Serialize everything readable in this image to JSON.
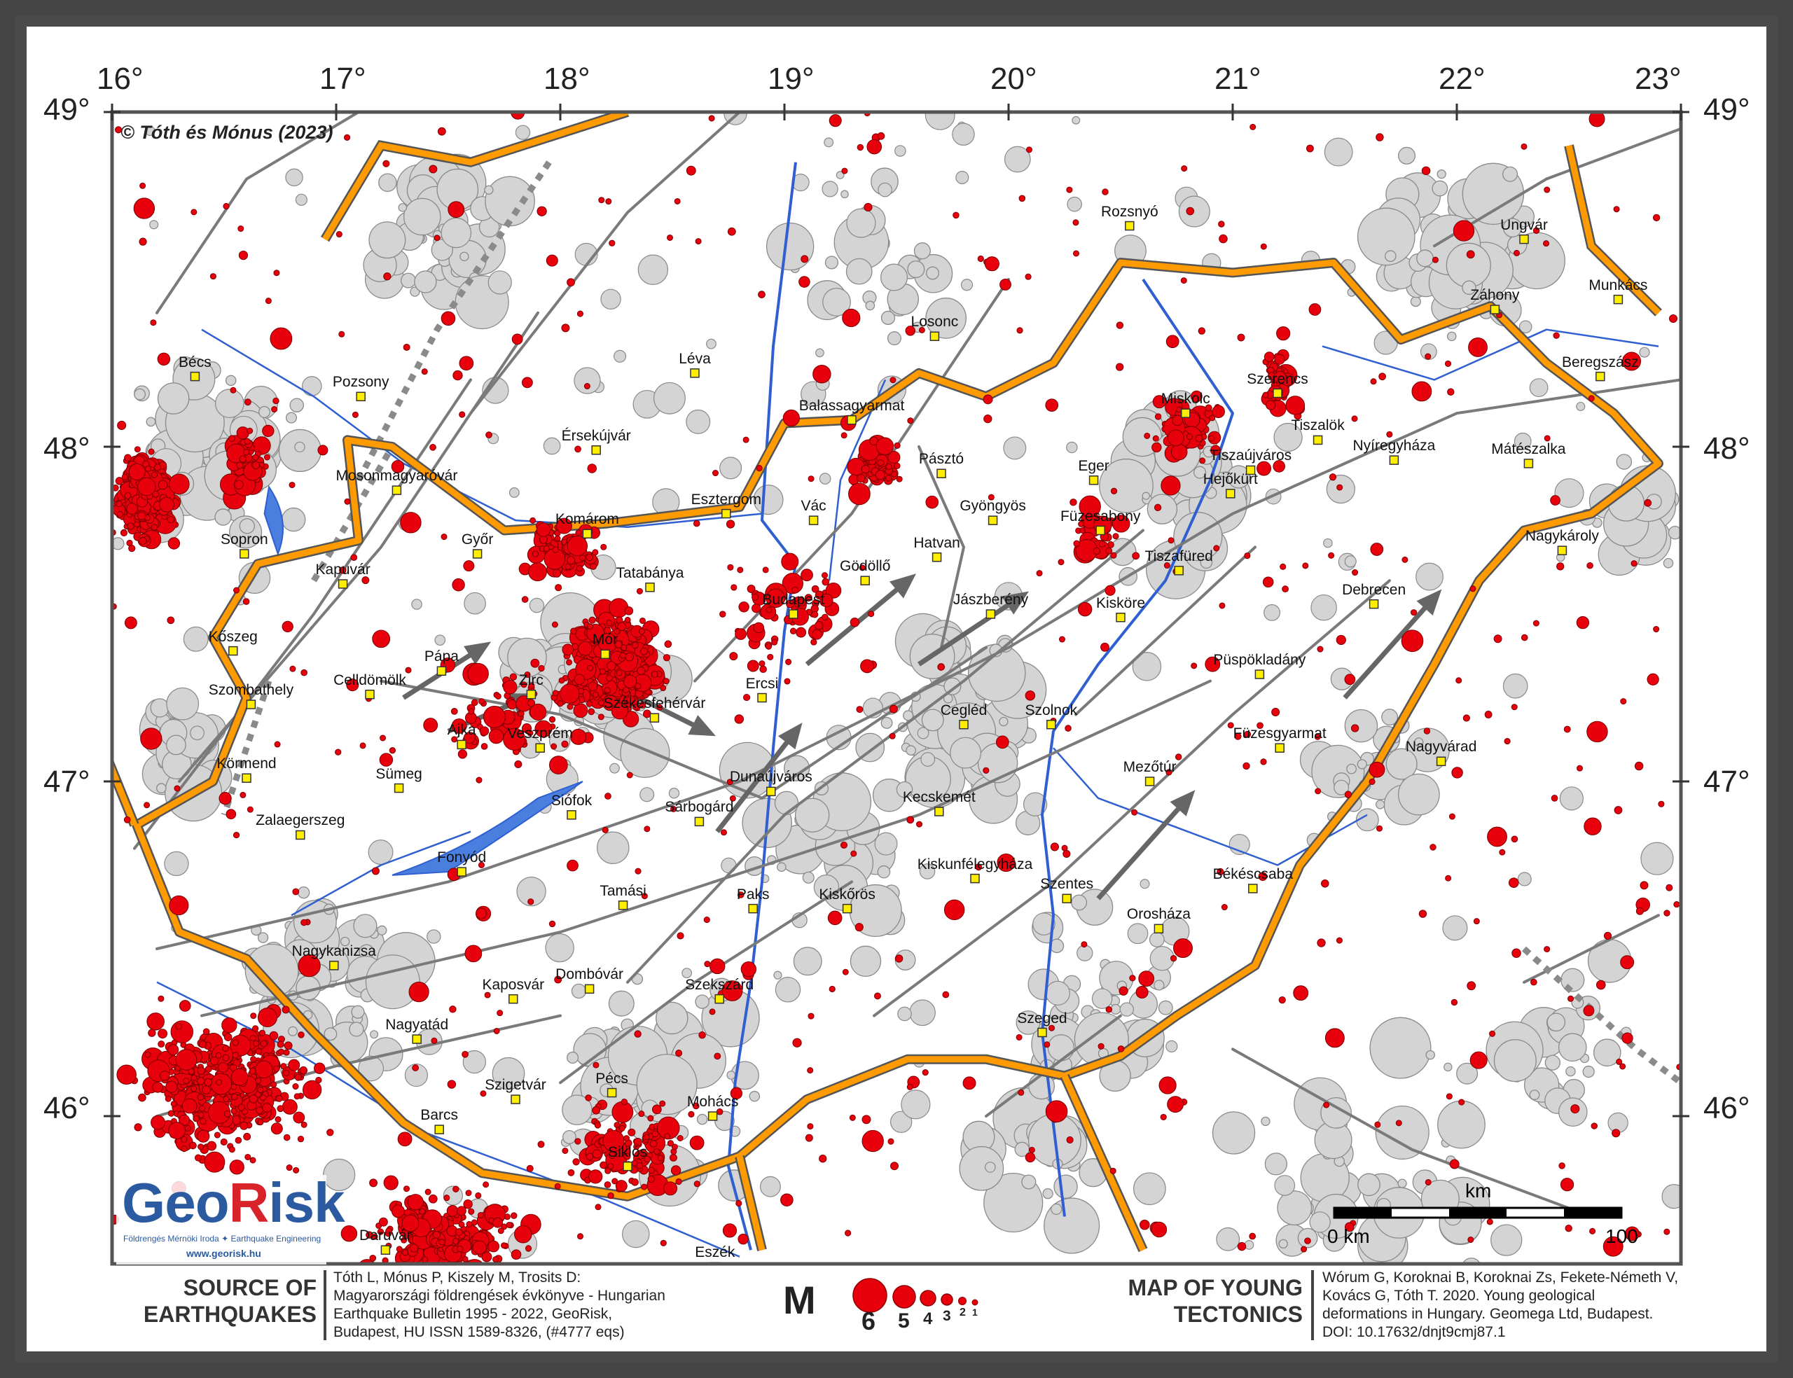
{
  "copyright": "© Tóth és Mónus (2023)",
  "longitude_labels": [
    "16°",
    "17°",
    "18°",
    "19°",
    "20°",
    "21°",
    "22°",
    "23°"
  ],
  "latitude_labels": [
    "49°",
    "48°",
    "47°",
    "46°"
  ],
  "cities": [
    {
      "name": "Rozsnyó",
      "lon": 20.54,
      "lat": 48.66
    },
    {
      "name": "Ungvár",
      "lon": 22.3,
      "lat": 48.62
    },
    {
      "name": "Munkács",
      "lon": 22.72,
      "lat": 48.44
    },
    {
      "name": "Záhony",
      "lon": 22.17,
      "lat": 48.41
    },
    {
      "name": "Losonc",
      "lon": 19.67,
      "lat": 48.33
    },
    {
      "name": "Bécs",
      "lon": 16.37,
      "lat": 48.21
    },
    {
      "name": "Léva",
      "lon": 18.6,
      "lat": 48.22
    },
    {
      "name": "Pozsony",
      "lon": 17.11,
      "lat": 48.15
    },
    {
      "name": "Beregszász",
      "lon": 22.64,
      "lat": 48.21
    },
    {
      "name": "Szerencs",
      "lon": 21.2,
      "lat": 48.16
    },
    {
      "name": "Balassagyarmat",
      "lon": 19.3,
      "lat": 48.08
    },
    {
      "name": "Miskolc",
      "lon": 20.79,
      "lat": 48.1
    },
    {
      "name": "Tiszalök",
      "lon": 21.38,
      "lat": 48.02
    },
    {
      "name": "Mátészalka",
      "lon": 22.32,
      "lat": 47.95
    },
    {
      "name": "Nyíregyháza",
      "lon": 21.72,
      "lat": 47.96
    },
    {
      "name": "Érsekújvár",
      "lon": 18.16,
      "lat": 47.99
    },
    {
      "name": "Tiszaújváros",
      "lon": 21.08,
      "lat": 47.93
    },
    {
      "name": "Pásztó",
      "lon": 19.7,
      "lat": 47.92
    },
    {
      "name": "Eger",
      "lon": 20.38,
      "lat": 47.9
    },
    {
      "name": "Mosonmagyaróvár",
      "lon": 17.27,
      "lat": 47.87
    },
    {
      "name": "Hejőkürt",
      "lon": 20.99,
      "lat": 47.86
    },
    {
      "name": "Esztergom",
      "lon": 18.74,
      "lat": 47.8
    },
    {
      "name": "Vác",
      "lon": 19.13,
      "lat": 47.78
    },
    {
      "name": "Gyöngyös",
      "lon": 19.93,
      "lat": 47.78
    },
    {
      "name": "Füzesabony",
      "lon": 20.41,
      "lat": 47.75
    },
    {
      "name": "Komárom",
      "lon": 18.12,
      "lat": 47.74
    },
    {
      "name": "Nagykároly",
      "lon": 22.47,
      "lat": 47.69
    },
    {
      "name": "Sopron",
      "lon": 16.59,
      "lat": 47.68
    },
    {
      "name": "Győr",
      "lon": 17.63,
      "lat": 47.68
    },
    {
      "name": "Hatvan",
      "lon": 19.68,
      "lat": 47.67
    },
    {
      "name": "Tiszafüred",
      "lon": 20.76,
      "lat": 47.63
    },
    {
      "name": "Gödöllő",
      "lon": 19.36,
      "lat": 47.6
    },
    {
      "name": "Tatabánya",
      "lon": 18.4,
      "lat": 47.58
    },
    {
      "name": "Kapuvár",
      "lon": 17.03,
      "lat": 47.59
    },
    {
      "name": "Debrecen",
      "lon": 21.63,
      "lat": 47.53
    },
    {
      "name": "Budapest",
      "lon": 19.04,
      "lat": 47.5
    },
    {
      "name": "Jászberény",
      "lon": 19.92,
      "lat": 47.5
    },
    {
      "name": "Kisköre",
      "lon": 20.5,
      "lat": 47.49
    },
    {
      "name": "Kőszeg",
      "lon": 16.54,
      "lat": 47.39
    },
    {
      "name": "Mór",
      "lon": 18.2,
      "lat": 47.38
    },
    {
      "name": "Püspökladány",
      "lon": 21.12,
      "lat": 47.32
    },
    {
      "name": "Pápa",
      "lon": 17.47,
      "lat": 47.33
    },
    {
      "name": "Celldömölk",
      "lon": 17.15,
      "lat": 47.26
    },
    {
      "name": "Zirc",
      "lon": 17.87,
      "lat": 47.26
    },
    {
      "name": "Ercsi",
      "lon": 18.9,
      "lat": 47.25
    },
    {
      "name": "Szombathely",
      "lon": 16.62,
      "lat": 47.23
    },
    {
      "name": "Székesfehérvár",
      "lon": 18.42,
      "lat": 47.19
    },
    {
      "name": "Cegléd",
      "lon": 19.8,
      "lat": 47.17
    },
    {
      "name": "Szolnok",
      "lon": 20.19,
      "lat": 47.17
    },
    {
      "name": "Ajka",
      "lon": 17.56,
      "lat": 47.11
    },
    {
      "name": "Veszprém",
      "lon": 17.91,
      "lat": 47.1
    },
    {
      "name": "Füzesgyarmat",
      "lon": 21.21,
      "lat": 47.1
    },
    {
      "name": "Nagyvárad",
      "lon": 21.93,
      "lat": 47.06
    },
    {
      "name": "Mezőtúr",
      "lon": 20.63,
      "lat": 47.0
    },
    {
      "name": "Körmend",
      "lon": 16.6,
      "lat": 47.01
    },
    {
      "name": "Sümeg",
      "lon": 17.28,
      "lat": 46.98
    },
    {
      "name": "Dunaújváros",
      "lon": 18.94,
      "lat": 46.97
    },
    {
      "name": "Kecskemét",
      "lon": 19.69,
      "lat": 46.91
    },
    {
      "name": "Siófok",
      "lon": 18.05,
      "lat": 46.9
    },
    {
      "name": "Sárbogárd",
      "lon": 18.62,
      "lat": 46.88
    },
    {
      "name": "Zalaegerszeg",
      "lon": 16.84,
      "lat": 46.84
    },
    {
      "name": "Fonyód",
      "lon": 17.56,
      "lat": 46.73
    },
    {
      "name": "Kiskunfélegyháza",
      "lon": 19.85,
      "lat": 46.71
    },
    {
      "name": "Szentes",
      "lon": 20.26,
      "lat": 46.65
    },
    {
      "name": "Békéscsaba",
      "lon": 21.09,
      "lat": 46.68
    },
    {
      "name": "Tamási",
      "lon": 18.28,
      "lat": 46.63
    },
    {
      "name": "Paks",
      "lon": 18.86,
      "lat": 46.62
    },
    {
      "name": "Kiskőrös",
      "lon": 19.28,
      "lat": 46.62
    },
    {
      "name": "Orosháza",
      "lon": 20.67,
      "lat": 46.56
    },
    {
      "name": "Nagykanizsa",
      "lon": 16.99,
      "lat": 46.45
    },
    {
      "name": "Dombóvár",
      "lon": 18.13,
      "lat": 46.38
    },
    {
      "name": "Kaposvár",
      "lon": 17.79,
      "lat": 46.35
    },
    {
      "name": "Szekszárd",
      "lon": 18.71,
      "lat": 46.35
    },
    {
      "name": "Nagyatád",
      "lon": 17.36,
      "lat": 46.23
    },
    {
      "name": "Szeged",
      "lon": 20.15,
      "lat": 46.25
    },
    {
      "name": "Szigetvár",
      "lon": 17.8,
      "lat": 46.05
    },
    {
      "name": "Pécs",
      "lon": 18.23,
      "lat": 46.07
    },
    {
      "name": "Mohács",
      "lon": 18.68,
      "lat": 46.0
    },
    {
      "name": "Barcs",
      "lon": 17.46,
      "lat": 45.96
    },
    {
      "name": "Siklós",
      "lon": 18.3,
      "lat": 45.85
    },
    {
      "name": "Daruvár",
      "lon": 17.22,
      "lat": 45.6
    },
    {
      "name": "Eszék",
      "lon": 18.69,
      "lat": 45.55
    }
  ],
  "logo": {
    "name_part1": "Geo",
    "name_part2": "R",
    "name_part3": "isk",
    "subtitle": "Földrengés Mérnöki Iroda ✦ Earthquake Engineering",
    "url": "www.georisk.hu"
  },
  "scale_bar": {
    "unit": "km",
    "start": "0 km",
    "end": "100"
  },
  "legend": {
    "source_heading": "SOURCE OF EARTHQUAKES",
    "source_heading_lines": [
      "SOURCE OF",
      "EARTHQUAKES"
    ],
    "source_text_lines": [
      "Tóth L, Mónus P, Kiszely M, Trosits D:",
      "Magyarországi földrengések évkönyve - Hungarian",
      "Earthquake Bulletin 1995 - 2022, GeoRisk,",
      "Budapest, HU ISSN 1589-8326, (#4777 eqs)"
    ],
    "magnitude_label": "M",
    "magnitudes": [
      "6",
      "5",
      "4",
      "3",
      "2",
      "1"
    ],
    "tectonics_heading_lines": [
      "MAP OF YOUNG",
      "TECTONICS"
    ],
    "tectonics_text_lines": [
      "Wórum G, Koroknai B, Koroknai Zs, Fekete-Németh V,",
      "Kovács G, Tóth T. 2020. Young geological",
      "deformations in Hungary. Geomega Ltd, Budapest.",
      "DOI: 10.17632/dnjt9cmj87.1"
    ]
  },
  "colors": {
    "border": "#ff9a00",
    "quake": "#e8000c",
    "historic": "#d4d4d4",
    "fault": "#7a7a7a",
    "river": "#2f5fd0",
    "city_marker": "#ffee00"
  }
}
